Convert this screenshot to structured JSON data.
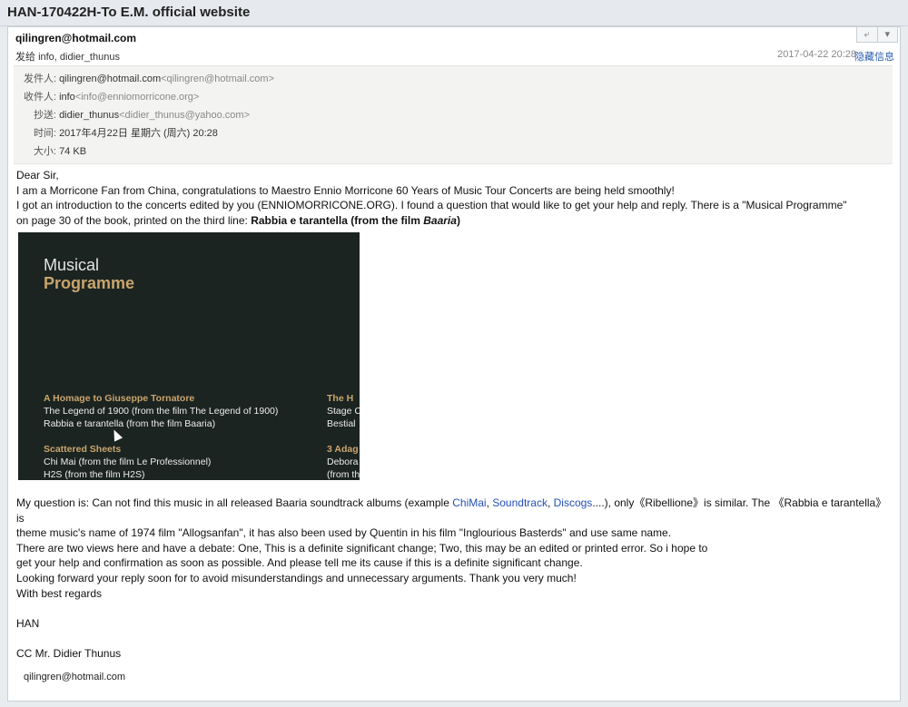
{
  "window": {
    "title": "HAN-170422H-To E.M. official website"
  },
  "header": {
    "from": "qilingren@hotmail.com",
    "to_label": "发给",
    "to": "info, didier_thunus",
    "date": "2017-04-22 20:28",
    "hide_label": "隐藏信息"
  },
  "meta": {
    "from_k": "发件人:",
    "from_v": "qilingren@hotmail.com",
    "from_g": "<qilingren@hotmail.com>",
    "to_k": "收件人:",
    "to_v": "info",
    "to_g": "<info@enniomorricone.org>",
    "cc_k": "抄送:",
    "cc_v": "didier_thunus",
    "cc_g": "<didier_thunus@yahoo.com>",
    "time_k": "时间:",
    "time_v": "2017年4月22日 星期六 (周六) 20:28",
    "size_k": "大小:",
    "size_v": "74 KB"
  },
  "body": {
    "l1": "Dear Sir,",
    "l2": "I am a Morricone Fan from China, congratulations to Maestro Ennio Morricone 60 Years of Music Tour Concerts are being held smoothly!",
    "l3": "I got an introduction to the concerts edited by you (ENNIOMORRICONE.ORG). I found a question that would like to get your help and reply. There is a \"Musical Programme\"",
    "l4a": "on page 30 of the book, printed on the third line: ",
    "l4b": "Rabbia e tarantella (from the film ",
    "l4c": "Baaria",
    "l4d": ")",
    "q1a": "My question is: Can not find this music in all released Baaria soundtrack albums (example ",
    "q1link1": "ChiMai",
    "q1sep1": ", ",
    "q1link2": "Soundtrack",
    "q1sep2": ", ",
    "q1link3": "Discogs",
    "q1b": "....), only《Ribellione》is similar. The 《Rabbia e tarantella》is",
    "q2": "theme music's name of 1974 film \"Allogsanfan\", it has also been used by Quentin in his film \"Inglourious Basterds\" and use same name.",
    "q3": "There are two views here and have a debate:  One, This is a definite significant change;  Two, this may be an edited or printed error. So i hope to",
    "q4": "get your help and confirmation as soon as possible. And please tell me its cause if this is a definite significant change.",
    "q5": "Looking forward your reply soon  for to avoid misunderstandings and unnecessary arguments.  Thank you very much!",
    "q6": "With best regards",
    "name": "HAN",
    "cc": "CC Mr. Didier Thunus",
    "signature": "qilingren@hotmail.com"
  },
  "photo": {
    "title1": "Musical",
    "title2": "Programme",
    "sec1": "A Homage to Giuseppe Tornatore",
    "sec1_l1": "The Legend of 1900 (from the film The Legend of 1900)",
    "sec1_l2": "Rabbia e tarantella (from the film Baaria)",
    "sec2": "Scattered Sheets",
    "sec2_l1": "Chi Mai (from the film Le Professionnel)",
    "sec2_l2": "H2S (from the film H2S)",
    "sec3": "The H",
    "sec3_l1": "Stage C",
    "sec3_l2": "Bestial",
    "sec4": "3 Adag",
    "sec4_l1": "Debora",
    "sec4_l2": "(from th"
  }
}
